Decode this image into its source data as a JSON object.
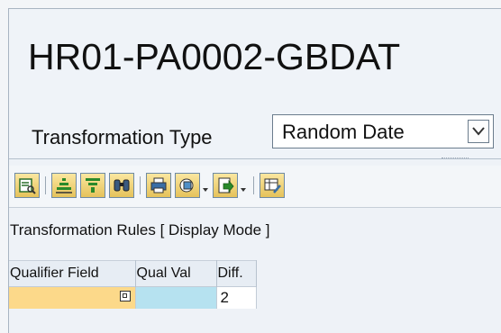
{
  "window": {
    "title": "HR01-PA0002-GBDAT"
  },
  "transformation": {
    "label": "Transformation Type",
    "selected": "Random Date"
  },
  "toolbar": {
    "buttons": [
      {
        "icon": "details-icon"
      },
      {
        "icon": "sort-icon"
      },
      {
        "icon": "filter-icon"
      },
      {
        "icon": "find-icon"
      },
      {
        "icon": "print-icon"
      },
      {
        "icon": "view-icon"
      },
      {
        "icon": "export-icon"
      },
      {
        "icon": "layout-icon"
      }
    ]
  },
  "grid": {
    "title": "Transformation Rules [ Display Mode ]",
    "columns": [
      "Qualifier Field",
      "Qual Val",
      "Diff."
    ],
    "rows": [
      {
        "qualifier": "",
        "qual_val": "",
        "diff": "2"
      }
    ]
  },
  "colors": {
    "qualifier_cell": "#fcd98a",
    "qual_val_cell": "#b6e2f0",
    "toolbar_button": "#e5c25a"
  }
}
